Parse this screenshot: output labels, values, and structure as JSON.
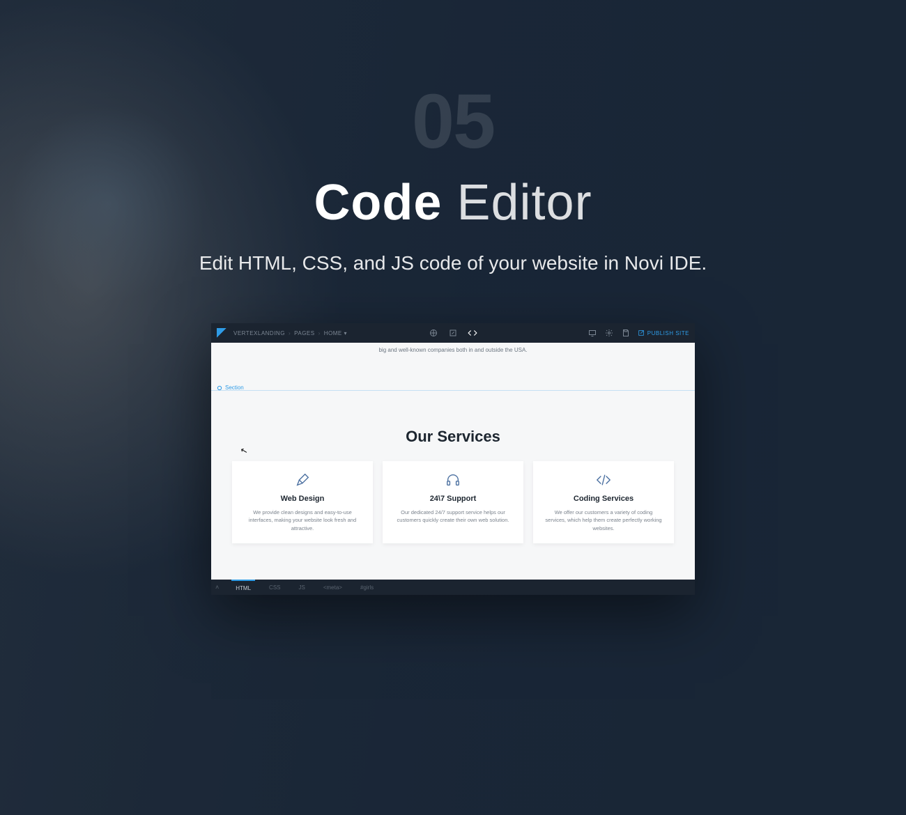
{
  "hero": {
    "number": "05",
    "title_bold": "Code",
    "title_light": "Editor",
    "subtitle": "Edit HTML, CSS, and JS code of your website in Novi IDE."
  },
  "ide": {
    "breadcrumb": {
      "root": "VERTEXLANDING",
      "sep": "›",
      "mid": "PAGES",
      "leaf": "HOME ▾"
    },
    "publish_label": "PUBLISH SITE",
    "canvas_top_text": "big and well-known companies both in and outside the USA.",
    "section_label": "Section",
    "services_heading": "Our Services",
    "cards": [
      {
        "title": "Web Design",
        "body": "We provide clean designs and easy-to-use interfaces, making your website look fresh and attractive."
      },
      {
        "title": "24\\7 Support",
        "body": "Our dedicated 24/7 support service helps our customers quickly create their own web solution."
      },
      {
        "title": "Coding Services",
        "body": "We offer our customers a variety of coding services, which help them create perfectly working websites."
      }
    ],
    "bottom_tabs": [
      "HTML",
      "CSS",
      "JS",
      "<meta>",
      "#girls"
    ]
  }
}
